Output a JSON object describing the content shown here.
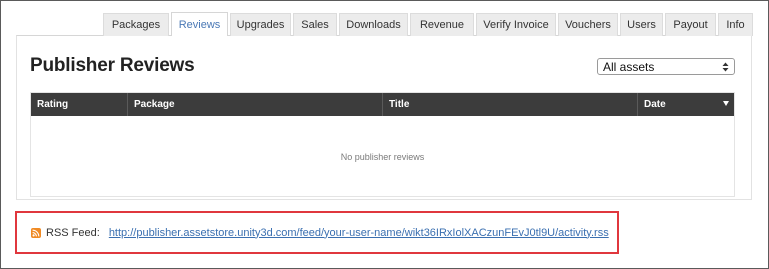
{
  "tabs": [
    {
      "label": "Packages",
      "active": false
    },
    {
      "label": "Reviews",
      "active": true
    },
    {
      "label": "Upgrades",
      "active": false
    },
    {
      "label": "Sales",
      "active": false
    },
    {
      "label": "Downloads",
      "active": false
    },
    {
      "label": "Revenue",
      "active": false
    },
    {
      "label": "Verify Invoice",
      "active": false
    },
    {
      "label": "Vouchers",
      "active": false
    },
    {
      "label": "Users",
      "active": false
    },
    {
      "label": "Payout",
      "active": false
    },
    {
      "label": "Info",
      "active": false
    }
  ],
  "page": {
    "title": "Publisher Reviews"
  },
  "asset_filter": {
    "selected": "All assets"
  },
  "table": {
    "columns": [
      "Rating",
      "Package",
      "Title",
      "Date"
    ],
    "sorted_column": "Date",
    "empty_message": "No publisher reviews"
  },
  "rss": {
    "label": "RSS Feed:",
    "url": "http://publisher.assetstore.unity3d.com/feed/your-user-name/wikt36IRxIolXACzunFEvJ0tl9U/activity.rss",
    "icon": "rss-icon"
  },
  "colors": {
    "active_tab_text": "#4a78b5",
    "table_header_bg": "#3c3c3c",
    "highlight_border": "#e0373d",
    "rss_icon": "#f08a24",
    "link": "#3a6fb0"
  }
}
